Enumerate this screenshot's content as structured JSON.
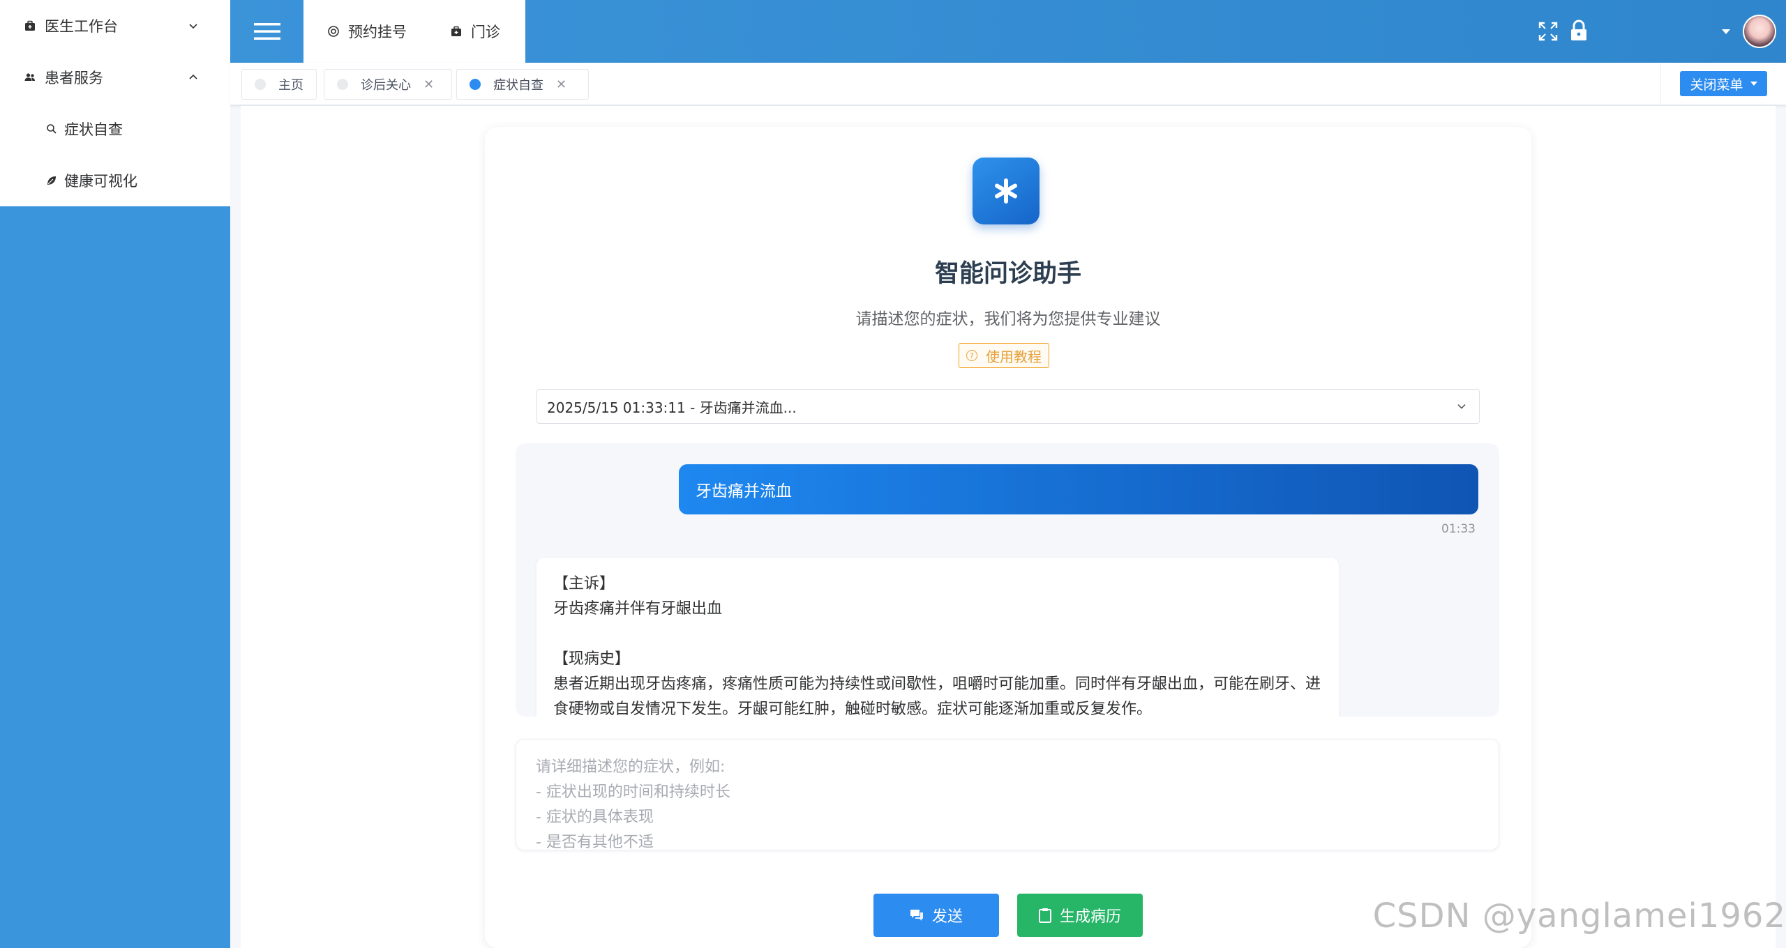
{
  "sidebar": {
    "items": [
      {
        "label": "医生工作台",
        "icon": "medkit-icon",
        "expanded": false
      },
      {
        "label": "患者服务",
        "icon": "users-icon",
        "expanded": true,
        "children": [
          {
            "label": "症状自查",
            "icon": "search-icon"
          },
          {
            "label": "健康可视化",
            "icon": "leaf-icon"
          }
        ]
      }
    ]
  },
  "header": {
    "top_tabs": [
      {
        "label": "预约挂号",
        "icon": "settings-circle-icon"
      },
      {
        "label": "门诊",
        "icon": "medkit-icon"
      }
    ],
    "icons": [
      "fullscreen-icon",
      "lock-icon",
      "dropdown-caret-icon",
      "avatar"
    ]
  },
  "tagbar": {
    "tags": [
      {
        "label": "主页",
        "active": false,
        "closable": false
      },
      {
        "label": "诊后关心",
        "active": false,
        "closable": true
      },
      {
        "label": "症状自查",
        "active": true,
        "closable": true
      }
    ],
    "close_menu_label": "关闭菜单"
  },
  "assistant": {
    "title": "智能问诊助手",
    "subtitle": "请描述您的症状，我们将为您提供专业建议",
    "tutorial_label": "使用教程",
    "session_select": "2025/5/15 01:33:11 - 牙齿痛并流血..."
  },
  "chat": {
    "user_message": "牙齿痛并流血",
    "user_time": "01:33",
    "ai_lines": {
      "chief_heading": "【主诉】",
      "chief_text": "牙齿疼痛并伴有牙龈出血",
      "history_heading": "【现病史】",
      "history_text": "患者近期出现牙齿疼痛，疼痛性质可能为持续性或间歇性，咀嚼时可能加重。同时伴有牙龈出血，可能在刷牙、进食硬物或自发情况下发生。牙龈可能红肿，触碰时敏感。症状可能逐渐加重或反复发作。"
    }
  },
  "input": {
    "placeholder_lines": [
      "请详细描述您的症状，例如:",
      "- 症状出现的时间和持续时长",
      "- 症状的具体表现",
      "- 是否有其他不适"
    ]
  },
  "actions": {
    "send_label": "发送",
    "generate_label": "生成病历"
  },
  "watermark": "CSDN @yanglamei1962",
  "colors": {
    "sidebar_bg": "#3a95dc",
    "primary": "#2d8cf0",
    "success": "#27b568",
    "warning": "#e6a23c"
  }
}
